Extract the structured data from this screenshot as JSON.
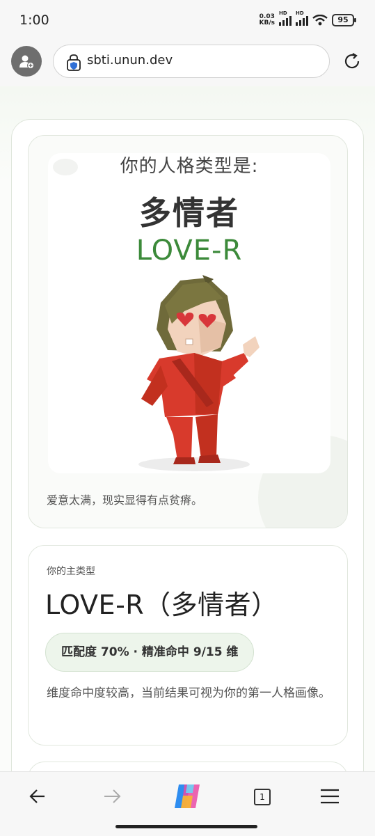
{
  "status": {
    "time": "1:00",
    "net_speed_value": "0.03",
    "net_speed_unit": "KB/s",
    "sim1_label": "HD",
    "sim2_label": "HD",
    "battery": "95"
  },
  "browser": {
    "url": "sbti.unun.dev",
    "tab_count": "1"
  },
  "result_card": {
    "poster_heading": "你的人格类型是:",
    "poster_name": "多情者",
    "poster_code": "LOVE-R",
    "tagline": "爱意太满，现实显得有点贫瘠。"
  },
  "main_type_card": {
    "label": "你的主类型",
    "title": "LOVE-R（多情者）",
    "match_badge": "匹配度 70% · 精准命中 9/15 维",
    "description": "维度命中度较高，当前结果可视为你的第一人格画像。"
  },
  "colors": {
    "accent_green": "#3c8a3a",
    "badge_bg": "#edf5eb"
  },
  "icons": [
    "profile-add-icon",
    "shield-lock-icon",
    "reload-icon",
    "back-arrow-icon",
    "forward-arrow-icon",
    "copilot-icon",
    "tabs-icon",
    "menu-icon"
  ]
}
